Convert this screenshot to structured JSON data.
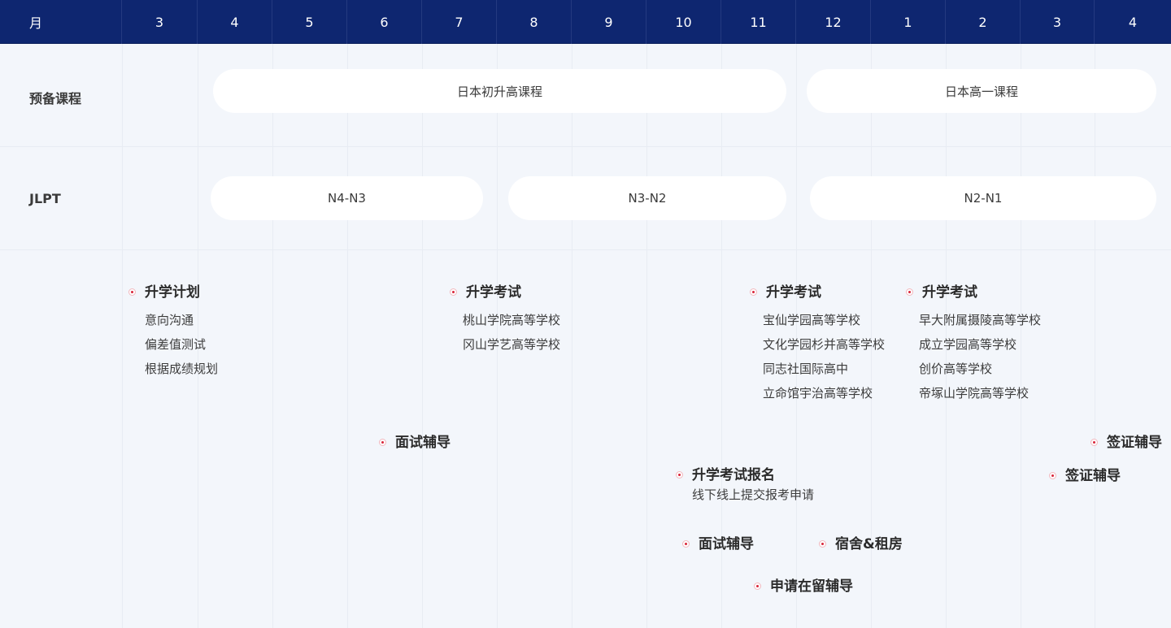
{
  "header": {
    "label": "月",
    "months": [
      "3",
      "4",
      "5",
      "6",
      "7",
      "8",
      "9",
      "10",
      "11",
      "12",
      "1",
      "2",
      "3",
      "4"
    ]
  },
  "rows": {
    "prep": {
      "label": "预备课程",
      "courses": [
        "日本初升高课程",
        "日本高一课程"
      ]
    },
    "jlpt": {
      "label": "JLPT",
      "levels": [
        "N4-N3",
        "N3-N2",
        "N2-N1"
      ]
    }
  },
  "events": {
    "plan": {
      "title": "升学计划",
      "items": [
        "意向沟通",
        "偏差值测试",
        "根据成绩规划"
      ]
    },
    "exam1": {
      "title": "升学考试",
      "items": [
        "桃山学院高等学校",
        "冈山学艺高等学校"
      ]
    },
    "exam2": {
      "title": "升学考试",
      "items": [
        "宝仙学园高等学校",
        "文化学园杉并高等学校",
        "同志社国际高中",
        "立命馆宇治高等学校"
      ]
    },
    "exam3": {
      "title": "升学考试",
      "items": [
        "早大附属摄陵高等学校",
        "成立学园高等学校",
        "创价高等学校",
        "帝塚山学院高等学校"
      ]
    },
    "interview1": {
      "title": "面试辅导"
    },
    "visa1": {
      "title": "签证辅导"
    },
    "register": {
      "title": "升学考试报名",
      "items": [
        "线下线上提交报考申请"
      ]
    },
    "visa2": {
      "title": "签证辅导"
    },
    "interview2": {
      "title": "面试辅导"
    },
    "housing": {
      "title": "宿舍&租房"
    },
    "residence": {
      "title": "申请在留辅导"
    }
  },
  "colors": {
    "header_bg": "#0e2670",
    "page_bg": "#f3f6fb",
    "pill_bg": "#ffffff",
    "dot_accent": "#d9253a"
  }
}
